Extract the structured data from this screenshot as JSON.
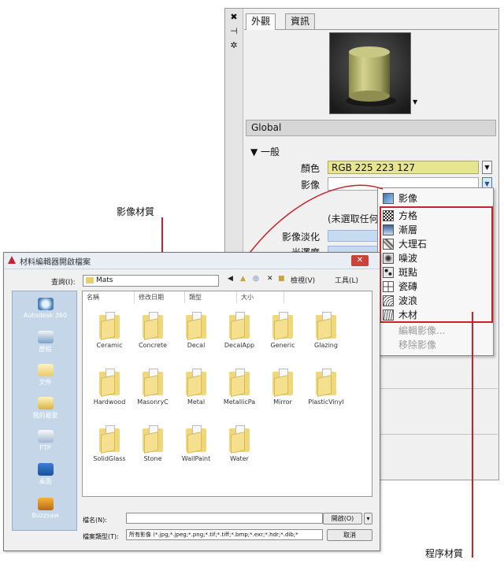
{
  "callouts": {
    "image_material": "影像材質",
    "procedural_material": "程序材質"
  },
  "editor": {
    "tabs": [
      "外觀",
      "資訊"
    ],
    "strip_icons": [
      "close-icon",
      "pin-icon",
      "properties-icon"
    ],
    "strip_glyphs": [
      "✖",
      "⊣",
      "✲"
    ],
    "preview_dropdown_glyph": "▼",
    "material_name": "Global",
    "section_header": "▼ 一般",
    "color_label": "顏色",
    "color_value": "RGB 225 223 127",
    "image_label": "影像",
    "no_image_text": "(未選取任何影",
    "image_fade_label": "影像淡化",
    "gloss_label": "光澤度",
    "colors": {
      "color_swatch": "#E1DF7F",
      "accent_red": "#C8232C"
    }
  },
  "menu": {
    "items": [
      {
        "label": "影像",
        "icon": "image-icon"
      },
      {
        "label": "方格",
        "icon": "checker-icon"
      },
      {
        "label": "漸層",
        "icon": "gradient-icon"
      },
      {
        "label": "大理石",
        "icon": "marble-icon"
      },
      {
        "label": "噪波",
        "icon": "noise-icon"
      },
      {
        "label": "斑點",
        "icon": "speckle-icon"
      },
      {
        "label": "瓷磚",
        "icon": "tiles-icon"
      },
      {
        "label": "波浪",
        "icon": "waves-icon"
      },
      {
        "label": "木材",
        "icon": "wood-icon"
      }
    ],
    "disabled_items": [
      "編輯影像...",
      "移除影像"
    ]
  },
  "dialog": {
    "title": "材料編輯器開啟檔案",
    "close_glyph": "✕",
    "look_in_label": "查詢(I):",
    "look_in_value": "Mats",
    "toolbar": {
      "views_label": "檢視(V)",
      "tools_label": "工具(L)"
    },
    "places": [
      "Autodesk 360",
      "歷程",
      "文件",
      "我的最愛",
      "FTP",
      "桌面",
      "Buzzsaw"
    ],
    "columns": [
      "名稱",
      "修改日期",
      "類型",
      "大小"
    ],
    "folders": [
      "Ceramic",
      "Concrete",
      "Decal",
      "DecalApp",
      "Generic",
      "Glazing",
      "Hardwood",
      "MasonryC",
      "Metal",
      "MetallicPa",
      "Mirror",
      "PlasticVinyl",
      "SolidGlass",
      "Stone",
      "WallPaint",
      "Water"
    ],
    "file_name_label": "檔名(N):",
    "file_type_label": "檔案類型(T):",
    "file_type_value": "所有影像 (*.jpg;*.jpeg;*.png;*.tif;*.tiff;*.bmp;*.exr;*.hdr;*.dib;*",
    "open_button": "開啟(O)",
    "cancel_button": "取消"
  }
}
